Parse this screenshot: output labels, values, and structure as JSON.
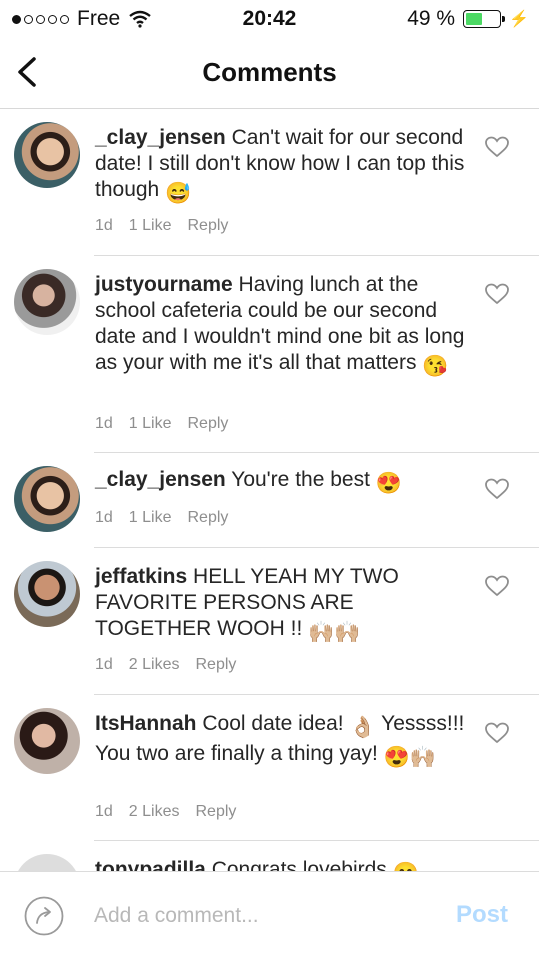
{
  "status_bar": {
    "carrier": "Free",
    "time": "20:42",
    "battery_pct": "49 %",
    "battery_level": 0.49,
    "signal_bars_filled": 1
  },
  "header": {
    "title": "Comments"
  },
  "comments": [
    {
      "username": "_clay_jensen",
      "text": "Can't wait for our second date! I still don't know how I can top this though",
      "emojis": [
        "😅"
      ],
      "age": "1d",
      "likes": "1 Like",
      "reply": "Reply"
    },
    {
      "username": "justyourname",
      "text": "Having lunch at the school cafeteria could be our second date and I wouldn't mind one bit as long as your with me it's all that matters",
      "emojis": [
        "😘"
      ],
      "age": "1d",
      "likes": "1 Like",
      "reply": "Reply"
    },
    {
      "username": "_clay_jensen",
      "text": "You're the best",
      "emojis": [
        "😍"
      ],
      "age": "1d",
      "likes": "1 Like",
      "reply": "Reply"
    },
    {
      "username": "jeffatkins",
      "text": "HELL YEAH MY TWO FAVORITE PERSONS ARE TOGETHER WOOH !!",
      "emojis": [
        "🙌🏼🙌🏼"
      ],
      "age": "1d",
      "likes": "2 Likes",
      "reply": "Reply"
    },
    {
      "username": "ItsHannah",
      "text": "Cool date idea!",
      "emoji_mid": "👌🏼",
      "text2": "Yessss!!! You two are finally a thing yay!",
      "emojis": [
        "😍🙌🏼"
      ],
      "age": "1d",
      "likes": "2 Likes",
      "reply": "Reply"
    },
    {
      "username": "tonypadilla",
      "text": "Congrats lovebirds",
      "emojis": [
        "😊"
      ]
    }
  ],
  "composer": {
    "placeholder": "Add a comment...",
    "post_label": "Post"
  },
  "colors": {
    "post_disabled": "#b3dbff",
    "battery": "#4cd964",
    "meta_gray": "#8e8e8e"
  }
}
